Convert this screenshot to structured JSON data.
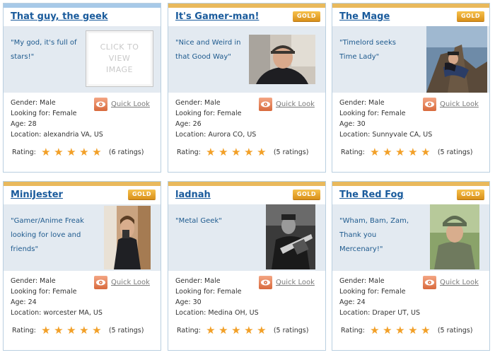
{
  "gold_badge_label": "GOLD",
  "quick_look_label": "Quick Look",
  "rating_label": "Rating:",
  "click_to_view_image": "CLICK TO VIEW IMAGE",
  "accent_colors": {
    "link": "#1a5b9c",
    "gold": "#e9b95c",
    "blue_bar": "#a7c9e8",
    "star": "#f2a028"
  },
  "profiles": [
    {
      "name": "That guy, the geek",
      "gold": false,
      "quote": "\"My god, it's full of stars!\"",
      "photo": "none",
      "gender": "Gender: Male",
      "looking": "Looking for: Female",
      "age": "Age: 28",
      "location": "Location: alexandria VA, US",
      "stars": 5,
      "ratings": "(6 ratings)"
    },
    {
      "name": "It's Gamer-man!",
      "gold": true,
      "quote": "\"Nice and Weird in that Good Way\"",
      "photo": "man-with-cap",
      "gender": "Gender: Male",
      "looking": "Looking for: Female",
      "age": "Age: 26",
      "location": "Location: Aurora CO, US",
      "stars": 5,
      "ratings": "(5 ratings)"
    },
    {
      "name": "The Mage",
      "gold": true,
      "quote": "\"Timelord seeks Time Lady\"",
      "photo": "person-on-tree",
      "gender": "Gender: Male",
      "looking": "Looking for: Female",
      "age": "Age: 30",
      "location": "Location: Sunnyvale CA, US",
      "stars": 5,
      "ratings": "(5 ratings)"
    },
    {
      "name": "MiniJester",
      "gold": true,
      "quote": "\"Gamer/Anime Freak looking for love and friends\"",
      "photo": "mirror-selfie",
      "gender": "Gender: Male",
      "looking": "Looking for: Female",
      "age": "Age: 24",
      "location": "Location: worcester MA, US",
      "stars": 5,
      "ratings": "(5 ratings)"
    },
    {
      "name": "ladnah",
      "gold": true,
      "quote": "\"Metal Geek\"",
      "photo": "guitarist-bw",
      "gender": "Gender: Male",
      "looking": "Looking for: Female",
      "age": "Age: 30",
      "location": "Location: Medina OH, US",
      "stars": 5,
      "ratings": "(5 ratings)"
    },
    {
      "name": "The Red Fog",
      "gold": true,
      "quote": "\"Wham, Bam, Zam, Thank you Mercenary!\"",
      "photo": "soldier-portrait",
      "gender": "Gender: Male",
      "looking": "Looking for: Female",
      "age": "Age: 24",
      "location": "Location: Draper UT, US",
      "stars": 5,
      "ratings": "(5 ratings)"
    }
  ]
}
